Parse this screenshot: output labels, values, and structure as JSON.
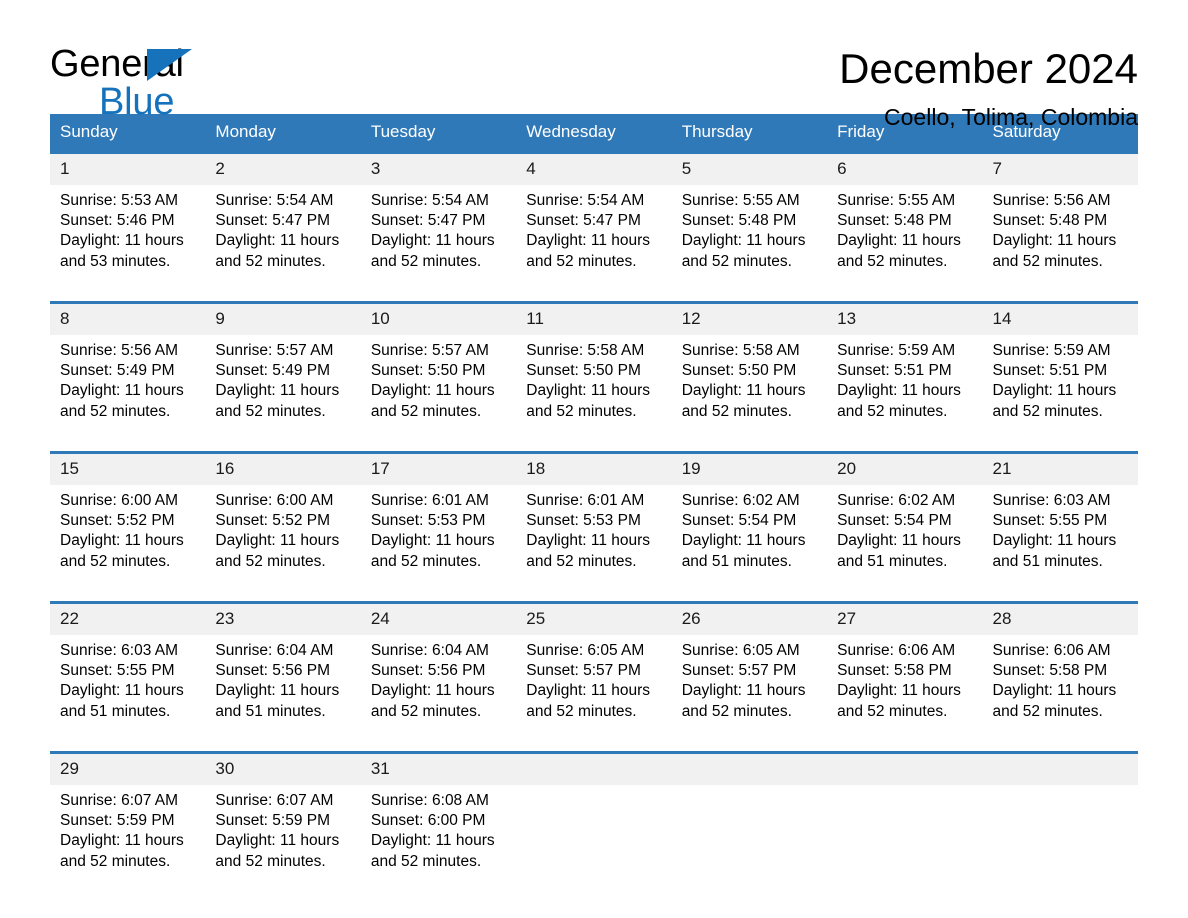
{
  "logo": {
    "word_black": "General",
    "word_blue": "Blue",
    "triangle_color": "#1673bb"
  },
  "header": {
    "title": "December 2024",
    "subtitle": "Coello, Tolima, Colombia",
    "header_bg": "#3079b9",
    "daynum_bg": "#f1f1f1"
  },
  "weekday_headers": [
    "Sunday",
    "Monday",
    "Tuesday",
    "Wednesday",
    "Thursday",
    "Friday",
    "Saturday"
  ],
  "labels": {
    "sunrise_prefix": "Sunrise:",
    "sunset_prefix": "Sunset:",
    "daylight_prefix": "Daylight:"
  },
  "weeks": [
    {
      "days": [
        {
          "num": "1",
          "sunrise": "Sunrise: 5:53 AM",
          "sunset": "Sunset: 5:46 PM",
          "daylight_l1": "Daylight: 11 hours",
          "daylight_l2": "and 53 minutes."
        },
        {
          "num": "2",
          "sunrise": "Sunrise: 5:54 AM",
          "sunset": "Sunset: 5:47 PM",
          "daylight_l1": "Daylight: 11 hours",
          "daylight_l2": "and 52 minutes."
        },
        {
          "num": "3",
          "sunrise": "Sunrise: 5:54 AM",
          "sunset": "Sunset: 5:47 PM",
          "daylight_l1": "Daylight: 11 hours",
          "daylight_l2": "and 52 minutes."
        },
        {
          "num": "4",
          "sunrise": "Sunrise: 5:54 AM",
          "sunset": "Sunset: 5:47 PM",
          "daylight_l1": "Daylight: 11 hours",
          "daylight_l2": "and 52 minutes."
        },
        {
          "num": "5",
          "sunrise": "Sunrise: 5:55 AM",
          "sunset": "Sunset: 5:48 PM",
          "daylight_l1": "Daylight: 11 hours",
          "daylight_l2": "and 52 minutes."
        },
        {
          "num": "6",
          "sunrise": "Sunrise: 5:55 AM",
          "sunset": "Sunset: 5:48 PM",
          "daylight_l1": "Daylight: 11 hours",
          "daylight_l2": "and 52 minutes."
        },
        {
          "num": "7",
          "sunrise": "Sunrise: 5:56 AM",
          "sunset": "Sunset: 5:48 PM",
          "daylight_l1": "Daylight: 11 hours",
          "daylight_l2": "and 52 minutes."
        }
      ]
    },
    {
      "days": [
        {
          "num": "8",
          "sunrise": "Sunrise: 5:56 AM",
          "sunset": "Sunset: 5:49 PM",
          "daylight_l1": "Daylight: 11 hours",
          "daylight_l2": "and 52 minutes."
        },
        {
          "num": "9",
          "sunrise": "Sunrise: 5:57 AM",
          "sunset": "Sunset: 5:49 PM",
          "daylight_l1": "Daylight: 11 hours",
          "daylight_l2": "and 52 minutes."
        },
        {
          "num": "10",
          "sunrise": "Sunrise: 5:57 AM",
          "sunset": "Sunset: 5:50 PM",
          "daylight_l1": "Daylight: 11 hours",
          "daylight_l2": "and 52 minutes."
        },
        {
          "num": "11",
          "sunrise": "Sunrise: 5:58 AM",
          "sunset": "Sunset: 5:50 PM",
          "daylight_l1": "Daylight: 11 hours",
          "daylight_l2": "and 52 minutes."
        },
        {
          "num": "12",
          "sunrise": "Sunrise: 5:58 AM",
          "sunset": "Sunset: 5:50 PM",
          "daylight_l1": "Daylight: 11 hours",
          "daylight_l2": "and 52 minutes."
        },
        {
          "num": "13",
          "sunrise": "Sunrise: 5:59 AM",
          "sunset": "Sunset: 5:51 PM",
          "daylight_l1": "Daylight: 11 hours",
          "daylight_l2": "and 52 minutes."
        },
        {
          "num": "14",
          "sunrise": "Sunrise: 5:59 AM",
          "sunset": "Sunset: 5:51 PM",
          "daylight_l1": "Daylight: 11 hours",
          "daylight_l2": "and 52 minutes."
        }
      ]
    },
    {
      "days": [
        {
          "num": "15",
          "sunrise": "Sunrise: 6:00 AM",
          "sunset": "Sunset: 5:52 PM",
          "daylight_l1": "Daylight: 11 hours",
          "daylight_l2": "and 52 minutes."
        },
        {
          "num": "16",
          "sunrise": "Sunrise: 6:00 AM",
          "sunset": "Sunset: 5:52 PM",
          "daylight_l1": "Daylight: 11 hours",
          "daylight_l2": "and 52 minutes."
        },
        {
          "num": "17",
          "sunrise": "Sunrise: 6:01 AM",
          "sunset": "Sunset: 5:53 PM",
          "daylight_l1": "Daylight: 11 hours",
          "daylight_l2": "and 52 minutes."
        },
        {
          "num": "18",
          "sunrise": "Sunrise: 6:01 AM",
          "sunset": "Sunset: 5:53 PM",
          "daylight_l1": "Daylight: 11 hours",
          "daylight_l2": "and 52 minutes."
        },
        {
          "num": "19",
          "sunrise": "Sunrise: 6:02 AM",
          "sunset": "Sunset: 5:54 PM",
          "daylight_l1": "Daylight: 11 hours",
          "daylight_l2": "and 51 minutes."
        },
        {
          "num": "20",
          "sunrise": "Sunrise: 6:02 AM",
          "sunset": "Sunset: 5:54 PM",
          "daylight_l1": "Daylight: 11 hours",
          "daylight_l2": "and 51 minutes."
        },
        {
          "num": "21",
          "sunrise": "Sunrise: 6:03 AM",
          "sunset": "Sunset: 5:55 PM",
          "daylight_l1": "Daylight: 11 hours",
          "daylight_l2": "and 51 minutes."
        }
      ]
    },
    {
      "days": [
        {
          "num": "22",
          "sunrise": "Sunrise: 6:03 AM",
          "sunset": "Sunset: 5:55 PM",
          "daylight_l1": "Daylight: 11 hours",
          "daylight_l2": "and 51 minutes."
        },
        {
          "num": "23",
          "sunrise": "Sunrise: 6:04 AM",
          "sunset": "Sunset: 5:56 PM",
          "daylight_l1": "Daylight: 11 hours",
          "daylight_l2": "and 51 minutes."
        },
        {
          "num": "24",
          "sunrise": "Sunrise: 6:04 AM",
          "sunset": "Sunset: 5:56 PM",
          "daylight_l1": "Daylight: 11 hours",
          "daylight_l2": "and 52 minutes."
        },
        {
          "num": "25",
          "sunrise": "Sunrise: 6:05 AM",
          "sunset": "Sunset: 5:57 PM",
          "daylight_l1": "Daylight: 11 hours",
          "daylight_l2": "and 52 minutes."
        },
        {
          "num": "26",
          "sunrise": "Sunrise: 6:05 AM",
          "sunset": "Sunset: 5:57 PM",
          "daylight_l1": "Daylight: 11 hours",
          "daylight_l2": "and 52 minutes."
        },
        {
          "num": "27",
          "sunrise": "Sunrise: 6:06 AM",
          "sunset": "Sunset: 5:58 PM",
          "daylight_l1": "Daylight: 11 hours",
          "daylight_l2": "and 52 minutes."
        },
        {
          "num": "28",
          "sunrise": "Sunrise: 6:06 AM",
          "sunset": "Sunset: 5:58 PM",
          "daylight_l1": "Daylight: 11 hours",
          "daylight_l2": "and 52 minutes."
        }
      ]
    },
    {
      "days": [
        {
          "num": "29",
          "sunrise": "Sunrise: 6:07 AM",
          "sunset": "Sunset: 5:59 PM",
          "daylight_l1": "Daylight: 11 hours",
          "daylight_l2": "and 52 minutes."
        },
        {
          "num": "30",
          "sunrise": "Sunrise: 6:07 AM",
          "sunset": "Sunset: 5:59 PM",
          "daylight_l1": "Daylight: 11 hours",
          "daylight_l2": "and 52 minutes."
        },
        {
          "num": "31",
          "sunrise": "Sunrise: 6:08 AM",
          "sunset": "Sunset: 6:00 PM",
          "daylight_l1": "Daylight: 11 hours",
          "daylight_l2": "and 52 minutes."
        },
        {
          "num": "",
          "sunrise": "",
          "sunset": "",
          "daylight_l1": "",
          "daylight_l2": ""
        },
        {
          "num": "",
          "sunrise": "",
          "sunset": "",
          "daylight_l1": "",
          "daylight_l2": ""
        },
        {
          "num": "",
          "sunrise": "",
          "sunset": "",
          "daylight_l1": "",
          "daylight_l2": ""
        },
        {
          "num": "",
          "sunrise": "",
          "sunset": "",
          "daylight_l1": "",
          "daylight_l2": ""
        }
      ]
    }
  ]
}
